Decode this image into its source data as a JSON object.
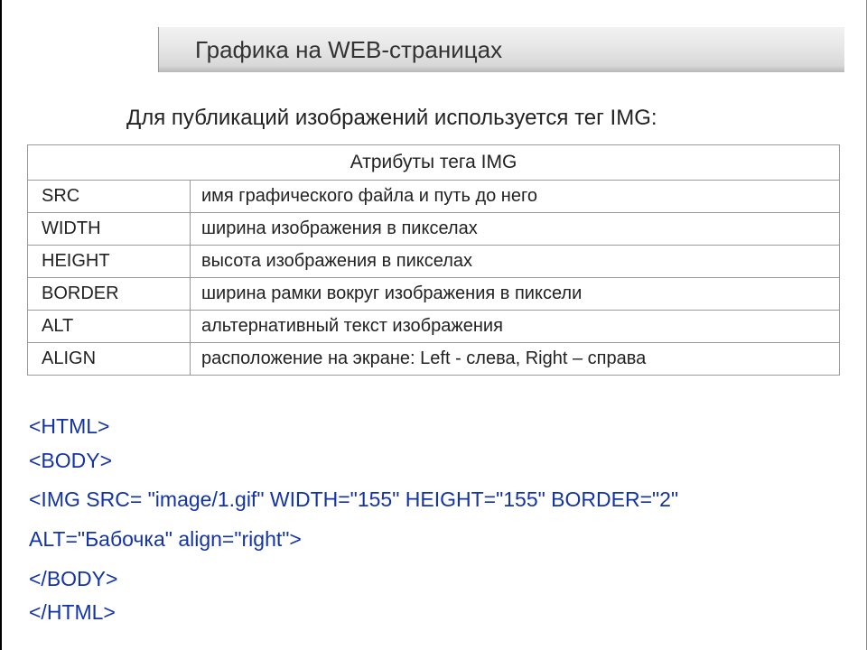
{
  "title": "Графика на WEB-страницах",
  "intro": "Для публикаций изображений используется тег IMG:",
  "table": {
    "header": "Атрибуты тега IMG",
    "rows": [
      {
        "attr": "SRC",
        "desc": "имя графического файла и путь до него"
      },
      {
        "attr": "WIDTH",
        "desc": "ширина изображения в пикселах"
      },
      {
        "attr": "HEIGHT",
        "desc": "высота изображения в пикселах"
      },
      {
        "attr": "BORDER",
        "desc": "ширина рамки вокруг изображения в пиксели"
      },
      {
        "attr": "ALT",
        "desc": "альтернативный текст изображения"
      },
      {
        "attr": "ALIGN",
        "desc": "расположение на экране: Left - слева, Right – справа"
      }
    ]
  },
  "code": {
    "line1": "<HTML>",
    "line2": "<BODY>",
    "line3": "<IMG SRC= \"image/1.gif\" WIDTH=\"155\" HEIGHT=\"155\" BORDER=\"2\"",
    "line4": "ALT=\"Бабочка\" align=\"right\">",
    "line5": "</BODY>",
    "line6": "</HTML>"
  }
}
